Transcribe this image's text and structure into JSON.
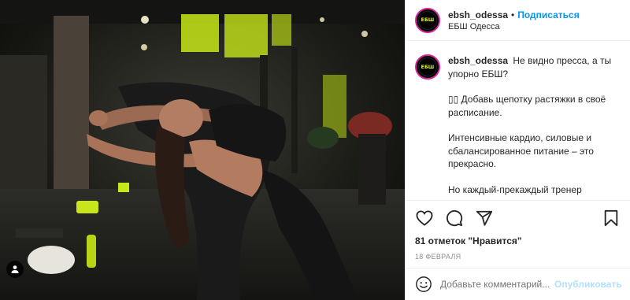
{
  "post": {
    "username": "ebsh_odessa",
    "separator": "•",
    "follow_label": "Подписаться",
    "location": "ЕБШ Одесса",
    "avatar_logo_text": "ЕБШ"
  },
  "caption": {
    "username": "ebsh_odessa",
    "line1": "Не видно пресса, а ты упорно ЕБШ?",
    "para2": "▯▯ Добавь щепотку растяжки в своё расписание.",
    "para3": "Интенсивные кардио, силовые и сбалансированное питание – это прекрасно.",
    "para4": "Но каждый-прекаждый тренер"
  },
  "actions": {
    "icons": [
      "heart-icon",
      "comment-icon",
      "share-icon",
      "bookmark-icon"
    ],
    "likes_text": "81 отметок \"Нравится\"",
    "date_text": "18 ФЕВРАЛЯ"
  },
  "comment": {
    "placeholder": "Добавьте комментарий...",
    "publish_label": "Опубликовать"
  },
  "colors": {
    "accent_blue": "#0095f6",
    "publish_disabled": "#b2dffc",
    "gym_neon": "#c8e619",
    "logo_yellow": "#e8ff00"
  }
}
